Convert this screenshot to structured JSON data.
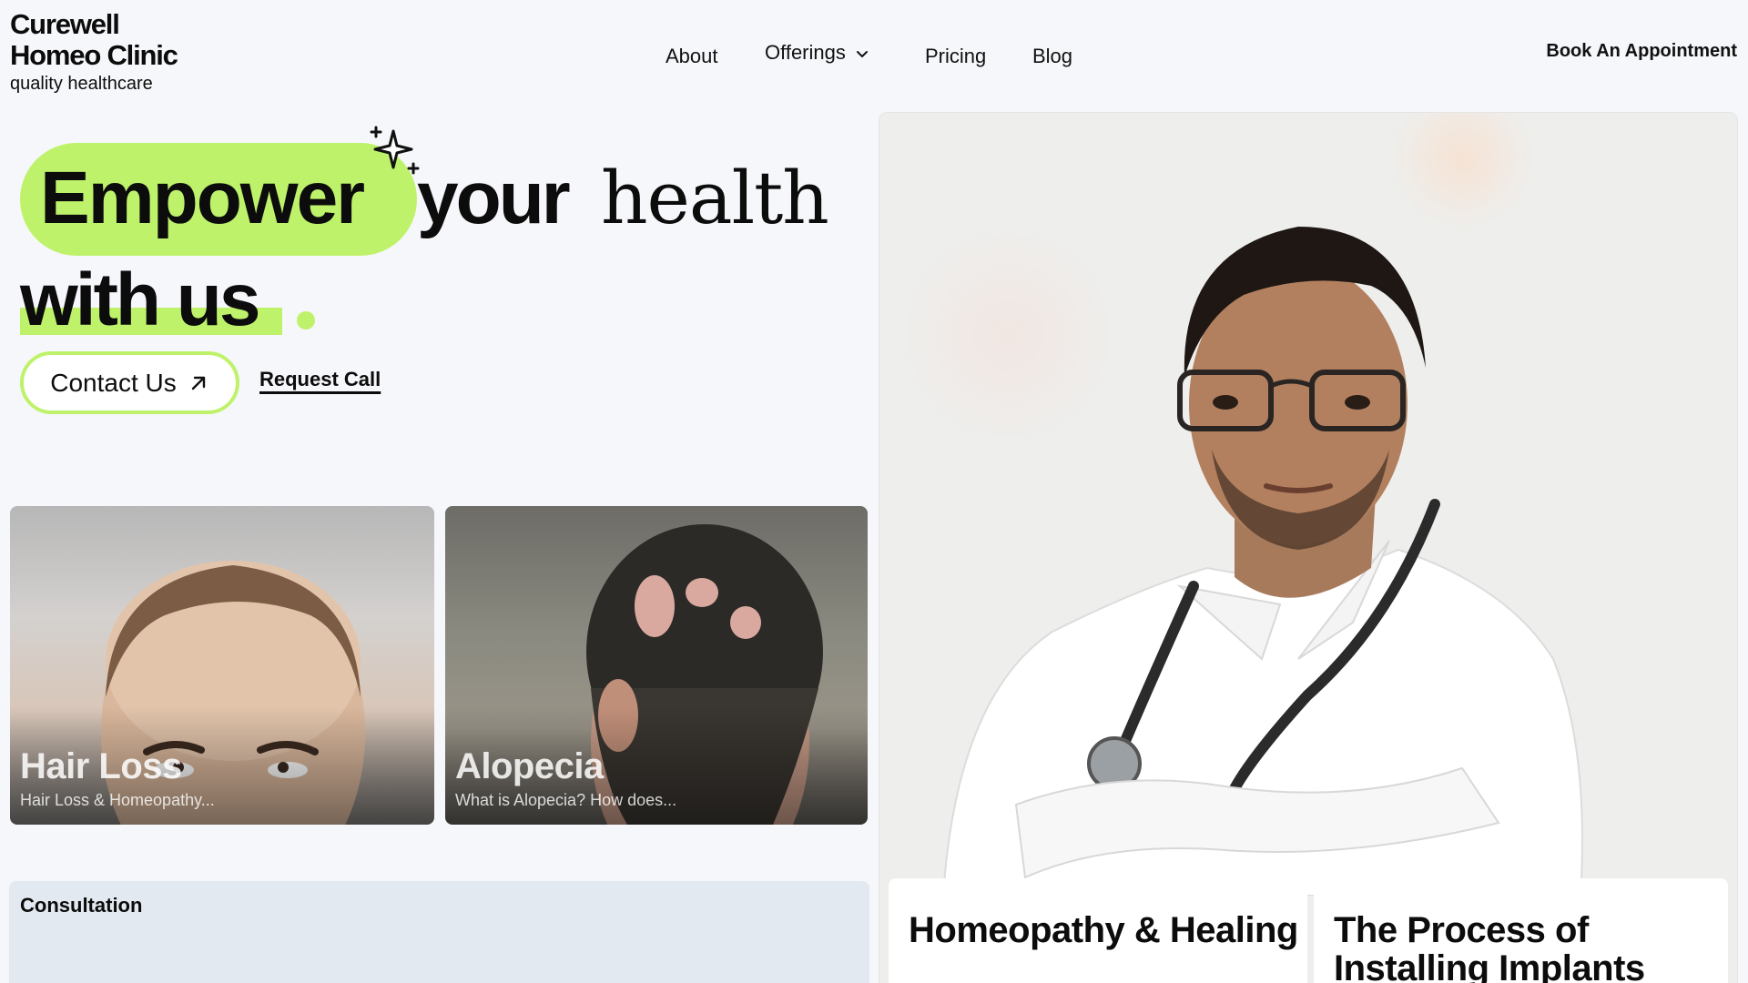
{
  "brand": {
    "name_line1": "Curewell",
    "name_line2": "Homeo Clinic",
    "tagline": "quality healthcare"
  },
  "nav": {
    "about": "About",
    "offerings": "Offerings",
    "pricing": "Pricing",
    "blog": "Blog",
    "book": "Book An Appointment"
  },
  "hero": {
    "word1": "Empower",
    "word2": "your",
    "word3": "health",
    "word4": "with us",
    "contact_label": "Contact Us",
    "request_label": "Request Call"
  },
  "cards": [
    {
      "title": "Hair Loss",
      "subtitle": "Hair Loss & Homeopathy..."
    },
    {
      "title": "Alopecia",
      "subtitle": "What is Alopecia? How does..."
    }
  ],
  "consultation": {
    "label": "Consultation"
  },
  "blog_cards": [
    {
      "title": "Homeopathy & Healing"
    },
    {
      "title": "The Process of Installing Implants"
    }
  ],
  "colors": {
    "accent": "#bff26b",
    "background": "#f6f7fa",
    "consult_bg": "#e3e9f1"
  },
  "icons": {
    "chevron": "chevron-down-icon",
    "arrow": "arrow-up-right-icon",
    "sparkle": "sparkle-icon"
  }
}
